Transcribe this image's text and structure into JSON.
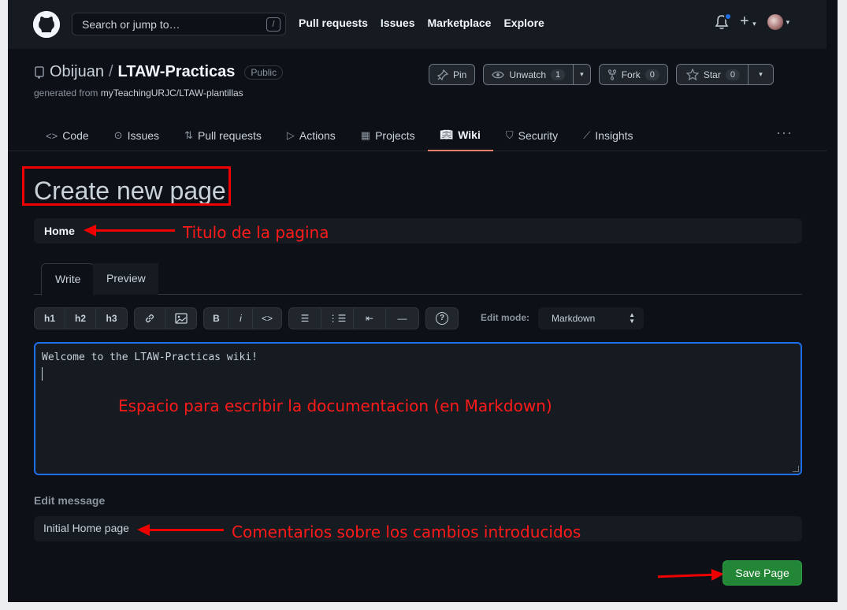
{
  "header": {
    "search_placeholder": "Search or jump to…",
    "search_shortcut": "/",
    "nav": [
      "Pull requests",
      "Issues",
      "Marketplace",
      "Explore"
    ],
    "plus": "+",
    "caret": "▾"
  },
  "repo": {
    "owner": "Obijuan",
    "separator": "/",
    "name": "LTAW-Practicas",
    "visibility": "Public",
    "generated_prefix": "generated from",
    "generated_link": "myTeachingURJC/LTAW-plantillas",
    "buttons": {
      "pin": "Pin",
      "unwatch": "Unwatch",
      "unwatch_count": "1",
      "fork": "Fork",
      "fork_count": "0",
      "star": "Star",
      "star_count": "0"
    },
    "tabs": [
      {
        "label": "Code",
        "icon": "code-icon"
      },
      {
        "label": "Issues",
        "icon": "issue-icon"
      },
      {
        "label": "Pull requests",
        "icon": "pull-request-icon"
      },
      {
        "label": "Actions",
        "icon": "play-icon"
      },
      {
        "label": "Projects",
        "icon": "project-icon"
      },
      {
        "label": "Wiki",
        "icon": "book-icon",
        "active": true
      },
      {
        "label": "Security",
        "icon": "shield-icon"
      },
      {
        "label": "Insights",
        "icon": "graph-icon"
      }
    ],
    "more": "···"
  },
  "wiki_form": {
    "page_heading": "Create new page",
    "title_value": "Home",
    "editor_tabs": {
      "write": "Write",
      "preview": "Preview"
    },
    "toolbar": {
      "h1": "h1",
      "h2": "h2",
      "h3": "h3",
      "bold": "B",
      "italic": "i",
      "help": "?"
    },
    "edit_mode_label": "Edit mode:",
    "edit_mode_value": "Markdown",
    "body_text": "Welcome to the LTAW-Practicas wiki!",
    "edit_message_label": "Edit message",
    "edit_message_value": "Initial Home page",
    "save_button": "Save Page"
  },
  "annotations": {
    "title": "Titulo de la pagina",
    "body": "Espacio para escribir la documentacion (en Markdown)",
    "message": "Comentarios sobre los cambios introducidos",
    "color": "#ff0000"
  },
  "colors": {
    "background": "#0d1117",
    "header": "#161b22",
    "accent_tab": "#f78166",
    "save_green": "#238636",
    "focus_blue": "#1f6feb"
  }
}
